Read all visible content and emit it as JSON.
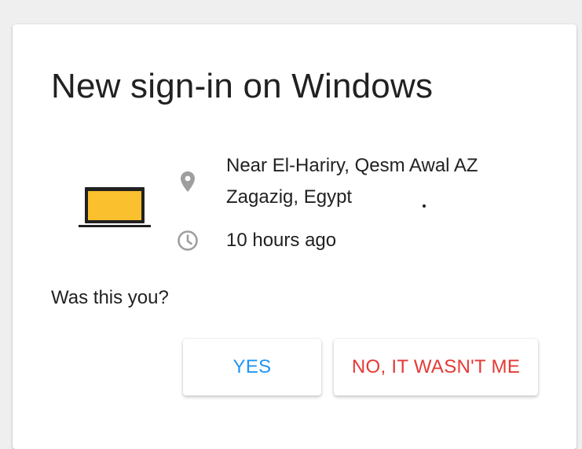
{
  "dialog": {
    "title": "New sign-in on Windows",
    "device_icon": "laptop-icon",
    "location": {
      "icon": "location-pin-icon",
      "line1": "Near El-Hariry, Qesm Awal AZ",
      "line2": "Zagazig, Egypt"
    },
    "time": {
      "icon": "clock-icon",
      "text": "10 hours ago"
    },
    "question": "Was this you?",
    "buttons": {
      "yes_label": "YES",
      "no_label": "NO, IT WASN'T ME"
    },
    "colors": {
      "yes": "#2196f3",
      "no": "#e53935",
      "laptop_screen": "#fbc02d",
      "icon_gray": "#9e9e9e"
    }
  }
}
